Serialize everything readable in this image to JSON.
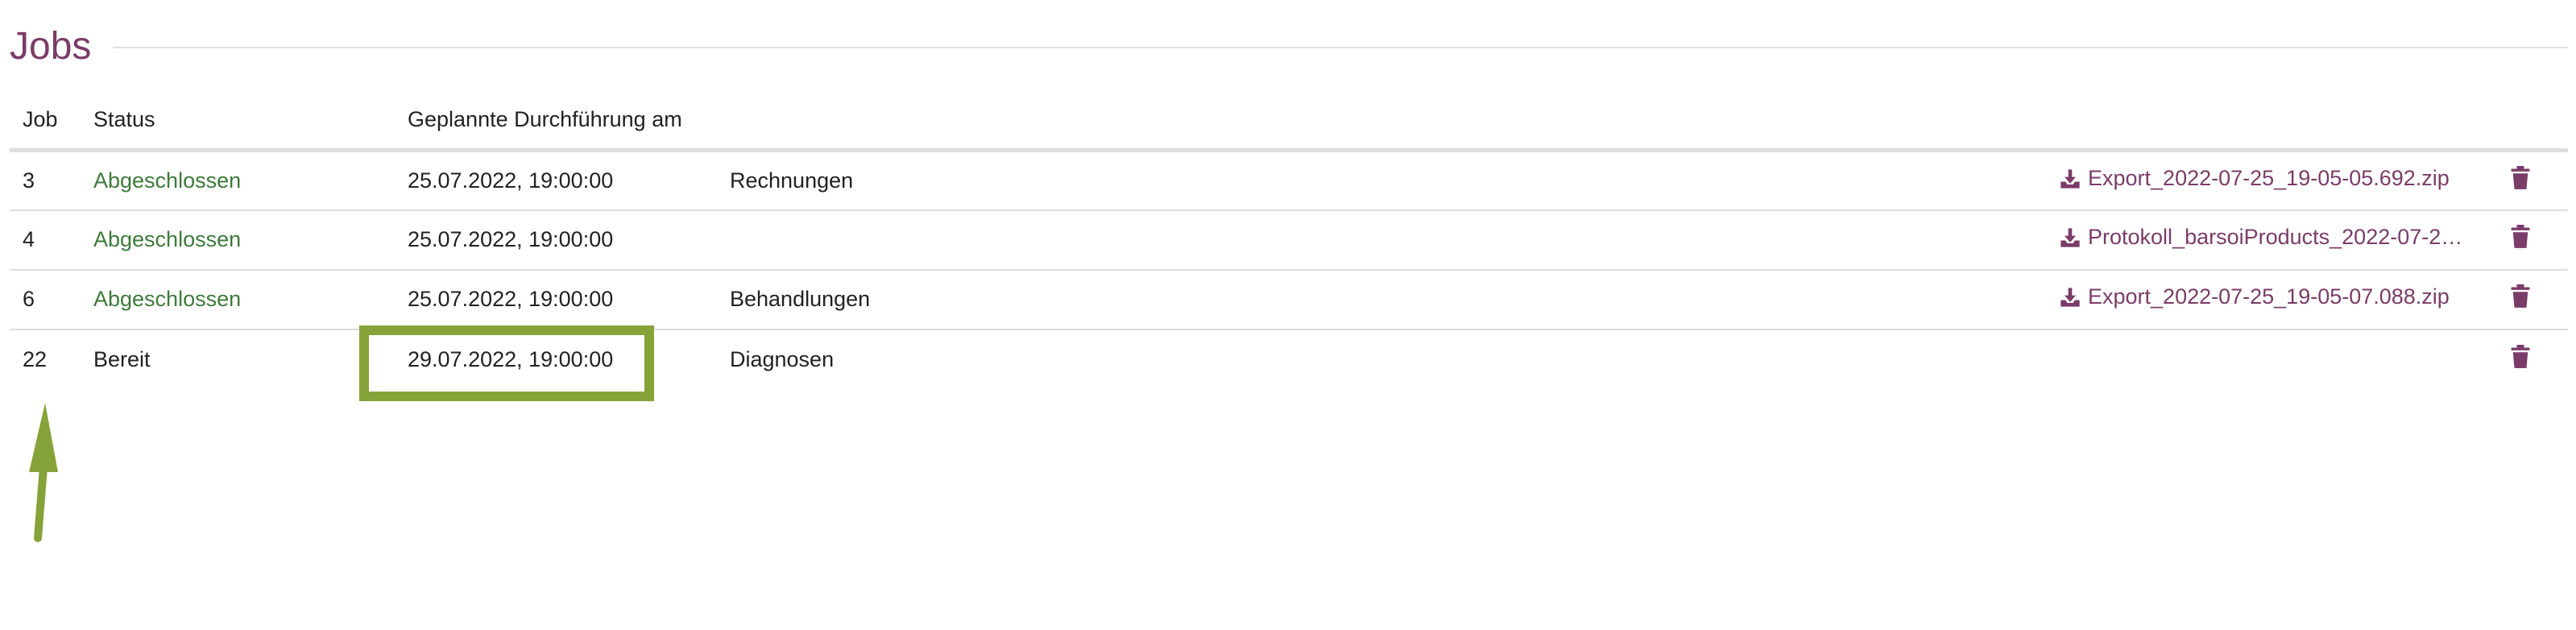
{
  "header": {
    "title": "Jobs"
  },
  "table": {
    "columns": [
      "Job",
      "Status",
      "Geplannte Durchführung am",
      "",
      "",
      ""
    ],
    "rows": [
      {
        "job": "3",
        "status": "Abgeschlossen",
        "status_kind": "done",
        "date": "25.07.2022, 19:00:00",
        "type": "Rechnungen",
        "file": "Export_2022-07-25_19-05-05.692.zip",
        "has_file": true
      },
      {
        "job": "4",
        "status": "Abgeschlossen",
        "status_kind": "done",
        "date": "25.07.2022, 19:00:00",
        "type": "",
        "file": "Protokoll_barsoiProducts_2022-07-2…",
        "has_file": true
      },
      {
        "job": "6",
        "status": "Abgeschlossen",
        "status_kind": "done",
        "date": "25.07.2022, 19:00:00",
        "type": "Behandlungen",
        "file": "Export_2022-07-25_19-05-07.088.zip",
        "has_file": true
      },
      {
        "job": "22",
        "status": "Bereit",
        "status_kind": "ready",
        "date": "29.07.2022, 19:00:00",
        "type": "Diagnosen",
        "file": "",
        "has_file": false
      }
    ]
  },
  "colors": {
    "accent": "#7a3c68",
    "status_done": "#3d7a3a",
    "annotation": "#86a33a"
  },
  "icons": {
    "download": "download-icon",
    "delete": "trash-icon"
  }
}
